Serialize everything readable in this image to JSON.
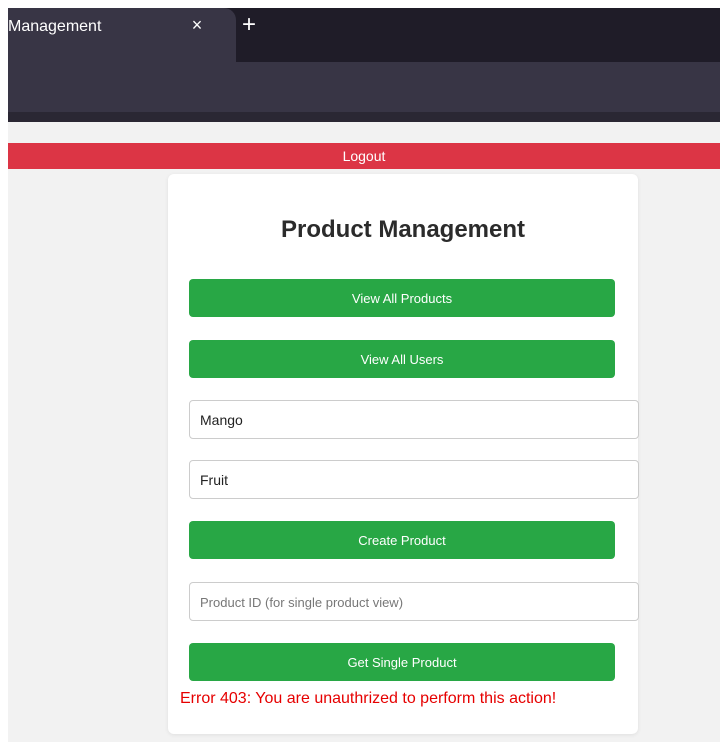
{
  "browser": {
    "tab_title": "Management",
    "close_glyph": "×",
    "new_tab_glyph": "+",
    "icons": {
      "close": "close-icon",
      "new_tab": "plus-icon"
    }
  },
  "page": {
    "logout_label": "Logout",
    "title": "Product Management",
    "buttons": {
      "view_all_products": "View All Products",
      "view_all_users": "View All Users",
      "create_product": "Create Product",
      "get_single_product": "Get Single Product"
    },
    "fields": {
      "product_name_value": "Mango",
      "product_category_value": "Fruit",
      "product_id_value": "",
      "product_id_placeholder": "Product ID (for single product view)"
    },
    "error_message": "Error 403: You are unauthrized to perform this action!"
  },
  "colors": {
    "accent_green": "#28a745",
    "logout_red": "#dc3545",
    "error_red": "#e60000",
    "chrome_dark": "#1f1c28",
    "chrome_mid": "#383545",
    "page_bg": "#f2f2f2"
  }
}
